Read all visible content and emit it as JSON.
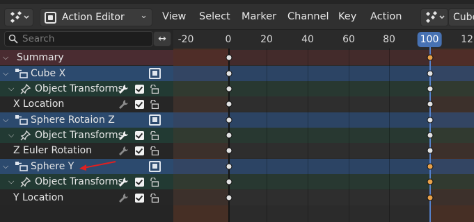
{
  "header": {
    "mode_label": "Action Editor",
    "menus": [
      "View",
      "Select",
      "Marker",
      "Channel",
      "Key",
      "Action"
    ],
    "action_name": "Cube"
  },
  "channels": {
    "search_placeholder": "Search",
    "swap_icon": "↔",
    "rows": [
      {
        "kind": "summary",
        "label": "Summary"
      },
      {
        "kind": "object",
        "label": "Cube X"
      },
      {
        "kind": "group",
        "label": "Object Transforms"
      },
      {
        "kind": "fcurve",
        "label": "X Location"
      },
      {
        "kind": "object",
        "label": "Sphere Rotaion Z"
      },
      {
        "kind": "group",
        "label": "Object Transforms"
      },
      {
        "kind": "fcurve",
        "label": "Z Euler Rotation"
      },
      {
        "kind": "object",
        "label": "Sphere Y"
      },
      {
        "kind": "group",
        "label": "Object Transforms"
      },
      {
        "kind": "fcurve",
        "label": "Y Location"
      }
    ]
  },
  "timeline": {
    "ticks": [
      "-20",
      "0",
      "20",
      "40",
      "60",
      "80",
      "12"
    ],
    "current_frame": "100",
    "keyframe_frames": [
      0,
      100
    ]
  },
  "colors": {
    "accent": "#4772b3",
    "summary_row": "#4a2c31",
    "object_row": "#2c4a6e",
    "group_row": "#223a33",
    "selected_keyframe": "#e8a14a",
    "annotation_arrow": "#e02020"
  },
  "icons": {
    "editor_type": "dopesheet-icon",
    "search": "search-icon",
    "object": "object-data-icon",
    "group": "pin-icon",
    "modifier": "wrench-icon",
    "enabled": "checkbox-icon",
    "lock": "lock-icon"
  }
}
